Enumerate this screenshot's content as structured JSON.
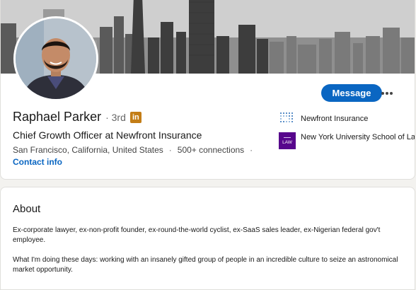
{
  "profile": {
    "name": "Raphael Parker",
    "degree": "· 3rd",
    "linkedin_badge": "in",
    "headline": "Chief Growth Officer at Newfront Insurance",
    "location": "San Francisco, California, United States",
    "connections": "500+ connections",
    "trailing_separator": "·",
    "contact_info": "Contact info",
    "message_label": "Message",
    "more_icon": "more-horizontal-icon"
  },
  "experience": [
    {
      "label": "Newfront Insurance",
      "logo": "newfront-logo"
    },
    {
      "label": "New York University School of Law",
      "logo": "nyu-law-logo",
      "logo_text": "LAW"
    }
  ],
  "about": {
    "title": "About",
    "paragraph1": "Ex-corporate lawyer, ex-non-profit founder, ex-round-the-world cyclist, ex-SaaS sales leader, ex-Nigerian federal gov't employee.",
    "paragraph2": "What I'm doing these days: working with an insanely gifted group of people in an incredible culture to seize an astronomical market opportunity."
  },
  "colors": {
    "accent": "#0a66c2",
    "linkedin_badge": "#c37d16",
    "nyu_purple": "#57068c"
  }
}
